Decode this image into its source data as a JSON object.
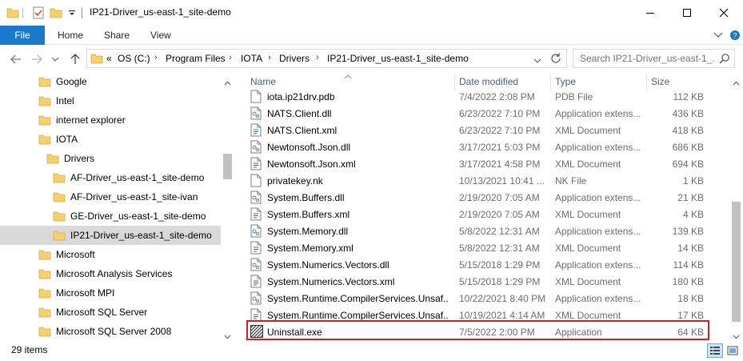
{
  "window": {
    "title": "IP21-Driver_us-east-1_site-demo",
    "minimize_icon": "minimize-icon",
    "maximize_icon": "maximize-icon",
    "close_icon": "close-icon"
  },
  "ribbon": {
    "tabs": [
      {
        "label": "File"
      },
      {
        "label": "Home"
      },
      {
        "label": "Share"
      },
      {
        "label": "View"
      }
    ]
  },
  "address": {
    "overflow": "«",
    "breadcrumbs": [
      "OS (C:)",
      "Program Files",
      "IOTA",
      "Drivers",
      "IP21-Driver_us-east-1_site-demo"
    ],
    "search_placeholder": "Search IP21-Driver_us-east-1_..."
  },
  "nav": {
    "items": [
      {
        "label": "Google",
        "indent": 0
      },
      {
        "label": "Intel",
        "indent": 0
      },
      {
        "label": "internet explorer",
        "indent": 0
      },
      {
        "label": "IOTA",
        "indent": 0
      },
      {
        "label": "Drivers",
        "indent": 1
      },
      {
        "label": "AF-Driver_us-east-1_site-demo",
        "indent": 2
      },
      {
        "label": "AF-Driver_us-east-1_site-ivan",
        "indent": 2
      },
      {
        "label": "GE-Driver_us-east-1_site-demo",
        "indent": 2
      },
      {
        "label": "IP21-Driver_us-east-1_site-demo",
        "indent": 2,
        "selected": true
      },
      {
        "label": "Microsoft",
        "indent": 0
      },
      {
        "label": "Microsoft Analysis Services",
        "indent": 0
      },
      {
        "label": "Microsoft MPI",
        "indent": 0
      },
      {
        "label": "Microsoft SQL Server",
        "indent": 0
      },
      {
        "label": "Microsoft SQL Server 2008",
        "indent": 0
      }
    ]
  },
  "files": {
    "columns": {
      "name": "Name",
      "date": "Date modified",
      "type": "Type",
      "size": "Size"
    },
    "rows": [
      {
        "name": "iota.ip21drv.pdb",
        "date": "7/4/2022 2:08 PM",
        "type": "PDB File",
        "size": "112 KB",
        "icon": "file-icon"
      },
      {
        "name": "NATS.Client.dll",
        "date": "6/23/2022 7:10 PM",
        "type": "Application extens...",
        "size": "436 KB",
        "icon": "dll-icon"
      },
      {
        "name": "NATS.Client.xml",
        "date": "6/23/2022 7:10 PM",
        "type": "XML Document",
        "size": "418 KB",
        "icon": "xml-icon"
      },
      {
        "name": "Newtonsoft.Json.dll",
        "date": "3/17/2021 5:03 PM",
        "type": "Application extens...",
        "size": "686 KB",
        "icon": "dll-icon"
      },
      {
        "name": "Newtonsoft.Json.xml",
        "date": "3/17/2021 4:58 PM",
        "type": "XML Document",
        "size": "694 KB",
        "icon": "xml-icon"
      },
      {
        "name": "privatekey.nk",
        "date": "10/13/2021 10:41 ...",
        "type": "NK File",
        "size": "1 KB",
        "icon": "file-icon"
      },
      {
        "name": "System.Buffers.dll",
        "date": "2/19/2020 7:05 AM",
        "type": "Application extens...",
        "size": "21 KB",
        "icon": "dll-icon"
      },
      {
        "name": "System.Buffers.xml",
        "date": "2/19/2020 7:05 AM",
        "type": "XML Document",
        "size": "4 KB",
        "icon": "xml-icon"
      },
      {
        "name": "System.Memory.dll",
        "date": "5/8/2022 12:31 AM",
        "type": "Application extens...",
        "size": "139 KB",
        "icon": "dll-icon"
      },
      {
        "name": "System.Memory.xml",
        "date": "5/8/2022 12:31 AM",
        "type": "XML Document",
        "size": "14 KB",
        "icon": "xml-icon"
      },
      {
        "name": "System.Numerics.Vectors.dll",
        "date": "5/15/2018 1:29 PM",
        "type": "Application extens...",
        "size": "114 KB",
        "icon": "dll-icon"
      },
      {
        "name": "System.Numerics.Vectors.xml",
        "date": "5/15/2018 1:29 PM",
        "type": "XML Document",
        "size": "180 KB",
        "icon": "xml-icon"
      },
      {
        "name": "System.Runtime.CompilerServices.Unsaf...",
        "date": "10/22/2021 8:40 PM",
        "type": "Application extens...",
        "size": "18 KB",
        "icon": "dll-icon"
      },
      {
        "name": "System.Runtime.CompilerServices.Unsaf...",
        "date": "10/19/2021 4:14 AM",
        "type": "XML Document",
        "size": "17 KB",
        "icon": "xml-icon"
      },
      {
        "name": "Uninstall.exe",
        "date": "7/5/2022 2:00 PM",
        "type": "Application",
        "size": "64 KB",
        "icon": "installer-icon",
        "highlighted": true
      }
    ]
  },
  "status": {
    "item_count": "29 items"
  },
  "colors": {
    "accent": "#1979ca",
    "highlight_border": "#d11e1e",
    "selected_nav": "#d9d9d9",
    "folder": "#f6d16b"
  }
}
